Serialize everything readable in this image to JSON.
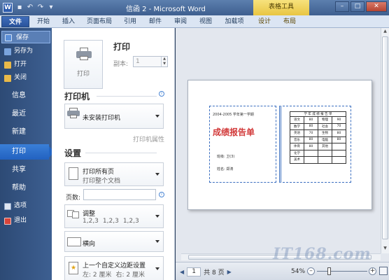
{
  "titlebar": {
    "app_letter": "W",
    "title": "信函 2 - Microsoft Word",
    "contextual_group": "表格工具",
    "controls": {
      "minimize": "–",
      "maximize": "□",
      "close": "✕"
    }
  },
  "quick_access": [
    "save-icon",
    "undo-icon",
    "redo-icon",
    "customize-icon"
  ],
  "tabs": {
    "file": "文件",
    "home": "开始",
    "insert": "插入",
    "layout": "页面布局",
    "references": "引用",
    "mailings": "邮件",
    "review": "审阅",
    "view": "视图",
    "addins": "加载项",
    "design": "设计",
    "table_layout": "布局"
  },
  "nav": {
    "save": "保存",
    "save_as": "另存为",
    "open": "打开",
    "close": "关闭",
    "info": "信息",
    "recent": "最近",
    "new": "新建",
    "print": "打印",
    "share": "共享",
    "help": "帮助",
    "options": "选项",
    "exit": "退出"
  },
  "print_panel": {
    "print_button": "打印",
    "heading": "打印",
    "copies_label": "副本:",
    "copies_value": "1",
    "printer_section": "打印机",
    "printer_name": "未安装打印机",
    "printer_properties": "打印机属性",
    "settings_section": "设置",
    "print_range_title": "打印所有页",
    "print_range_desc": "打印整个文档",
    "pages_label": "页数:",
    "pages_value": "",
    "collate_title": "调整",
    "collate_desc": [
      "1,2,3",
      "1,2,3",
      "1,2,3"
    ],
    "orientation": "横向",
    "margins_title": "上一个自定义边距设置",
    "margins_left": "左: 2 厘米",
    "margins_right": "右: 2 厘米"
  },
  "preview": {
    "semester": "2004-2005 学年第一学期",
    "report_title": "成绩报告单",
    "class_line": "班级: 卫(3)",
    "name_line": "姓名: 郑涛",
    "table_header": "学 年 成 绩 报 告 单",
    "table_rows": [
      [
        "语文",
        "80",
        "物理",
        "90"
      ],
      [
        "数学",
        "80",
        "社会",
        "70"
      ],
      [
        "英语",
        "70",
        "生物",
        "80"
      ],
      [
        "音乐",
        "80",
        "电脑",
        "80"
      ],
      [
        "体育",
        "80",
        "其他",
        ""
      ],
      [
        "化学",
        "",
        "",
        ""
      ],
      [
        "美术",
        "",
        "",
        ""
      ]
    ]
  },
  "statusbar": {
    "current_page": "1",
    "total_pages": "共 8 页",
    "zoom": "54%",
    "zoom_level_percent": 54
  },
  "watermark": "IT168.com"
}
